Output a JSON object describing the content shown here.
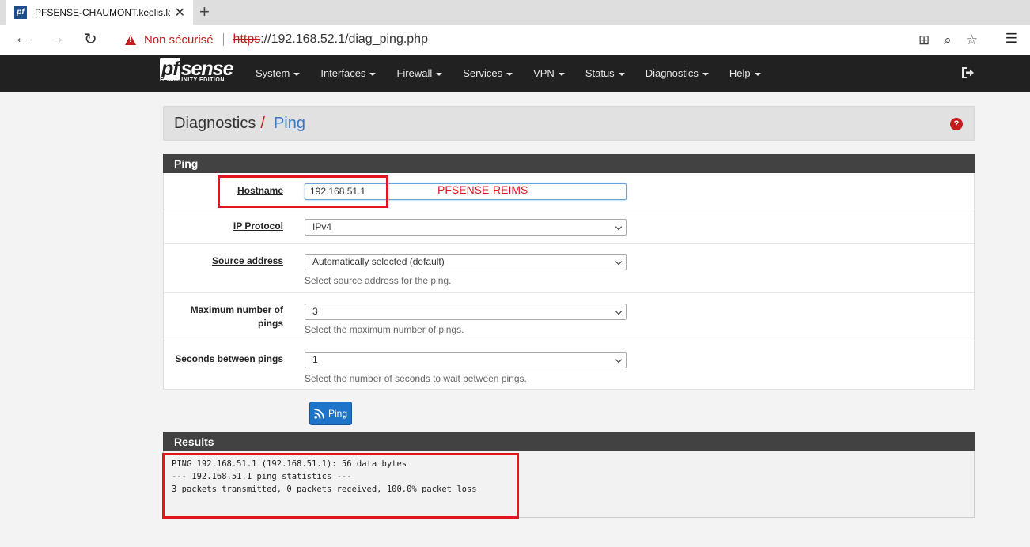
{
  "browser": {
    "tab_title": "PFSENSE-CHAUMONT.keolis.lan",
    "tab_favicon": "pf",
    "not_secure_label": "Non sécurisé",
    "url_protocol": "https",
    "url_rest": "://192.168.52.1/diag_ping.php"
  },
  "navbar": {
    "logo_text": "sense",
    "logo_pf": "pf",
    "logo_sub": "COMMUNITY EDITION",
    "menu": [
      "System",
      "Interfaces",
      "Firewall",
      "Services",
      "VPN",
      "Status",
      "Diagnostics",
      "Help"
    ]
  },
  "breadcrumb": {
    "parent": "Diagnostics",
    "separator": "/",
    "current": "Ping"
  },
  "ping_panel": {
    "title": "Ping",
    "hostname_label": "Hostname",
    "hostname_value": "192.168.51.1",
    "ip_protocol_label": "IP Protocol",
    "ip_protocol_value": "IPv4",
    "source_label": "Source address",
    "source_value": "Automatically selected (default)",
    "source_help": "Select source address for the ping.",
    "max_pings_label_1": "Maximum number of",
    "max_pings_label_2": "pings",
    "max_pings_value": "3",
    "max_pings_help": "Select the maximum number of pings.",
    "seconds_label": "Seconds between pings",
    "seconds_value": "1",
    "seconds_help": "Select the number of seconds to wait between pings.",
    "button_label": "Ping"
  },
  "results_panel": {
    "title": "Results",
    "lines": [
      "PING 192.168.51.1 (192.168.51.1): 56 data bytes",
      "",
      "--- 192.168.51.1 ping statistics ---",
      "3 packets transmitted, 0 packets received, 100.0% packet loss"
    ]
  },
  "annotation": {
    "text": "PFSENSE-REIMS",
    "color": "#e0161f"
  },
  "colors": {
    "navbar_bg": "#212121",
    "panel_head_bg": "#424242",
    "accent_blue": "#1e74c8",
    "danger_red": "#c41c1c"
  }
}
